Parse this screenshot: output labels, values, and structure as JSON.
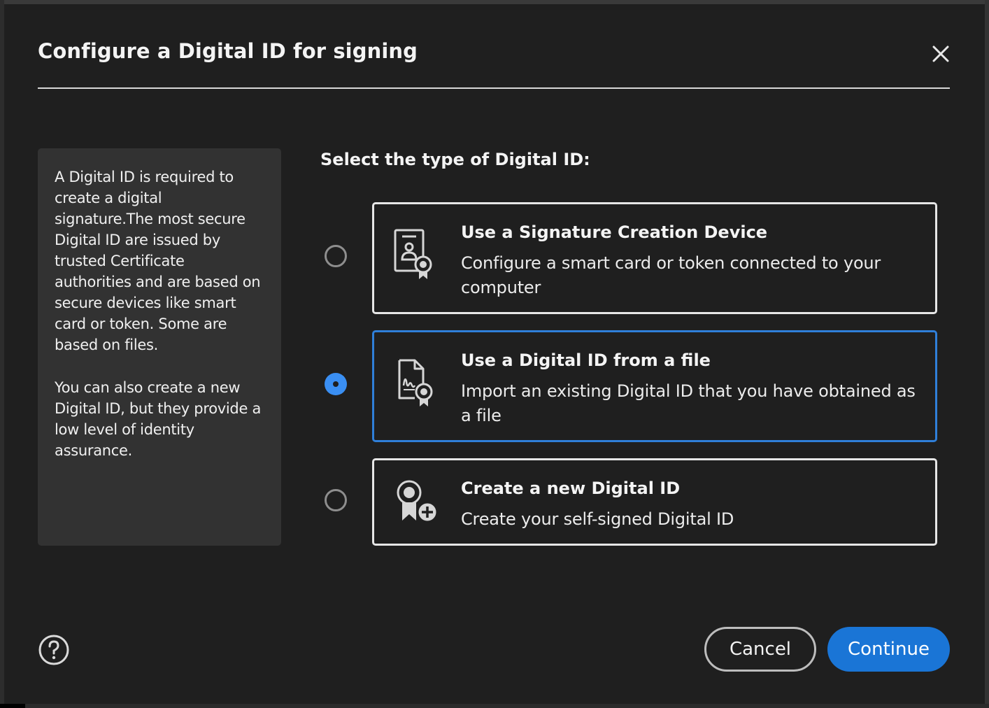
{
  "dialog": {
    "title": "Configure a Digital ID for signing",
    "close_icon": "close-icon"
  },
  "info": {
    "paragraph1": "A Digital ID is required to create a digital signature.The most secure Digital ID are issued by trusted Certificate authorities and are based on secure devices like smart card or token. Some are based on files.",
    "paragraph2": "You can also create a new Digital ID, but they provide a low level of identity assurance."
  },
  "selection": {
    "heading": "Select the type of Digital ID:",
    "selected_index": 1,
    "options": [
      {
        "title": "Use a Signature Creation Device",
        "description": "Configure a smart card or token connected to your computer",
        "icon": "smart-card-certificate-icon"
      },
      {
        "title": "Use a Digital ID from a file",
        "description": "Import an existing Digital ID that you have obtained as a file",
        "icon": "signed-file-certificate-icon"
      },
      {
        "title": "Create a new Digital ID",
        "description": "Create your self-signed Digital ID",
        "icon": "certificate-add-icon"
      }
    ]
  },
  "footer": {
    "help_icon": "help-icon",
    "cancel_label": "Cancel",
    "continue_label": "Continue"
  },
  "colors": {
    "background": "#1f1f1f",
    "panel": "#323232",
    "accent": "#1a75d6",
    "selected_border": "#2f7fd9",
    "radio_selected": "#3a8ff3"
  }
}
